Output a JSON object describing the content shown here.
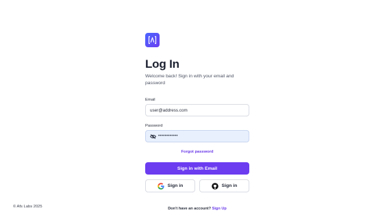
{
  "brand": {
    "logo_icon": "bracket-logo-icon",
    "accent_color": "#6b3cf0",
    "logo_gradient": [
      "#4a66ff",
      "#6a3df0"
    ]
  },
  "login": {
    "title": "Log In",
    "subtitle": "Welcome back! Sign in with your email and password",
    "email_label": "Email",
    "email_value": "user@address.com",
    "password_label": "Password",
    "password_value": "••••••••••••",
    "password_visibility_icon": "eye-off-icon",
    "forgot_password": "Forgot password",
    "submit_label": "Sign in with Email",
    "google_label": "Sign in",
    "google_icon": "google-icon",
    "github_label": "Sign in",
    "github_icon": "github-icon"
  },
  "footer": {
    "copyright": "© Afs Labs 2025",
    "signup_prompt": "Don't have an account?",
    "signup_link": "Sign Up"
  }
}
